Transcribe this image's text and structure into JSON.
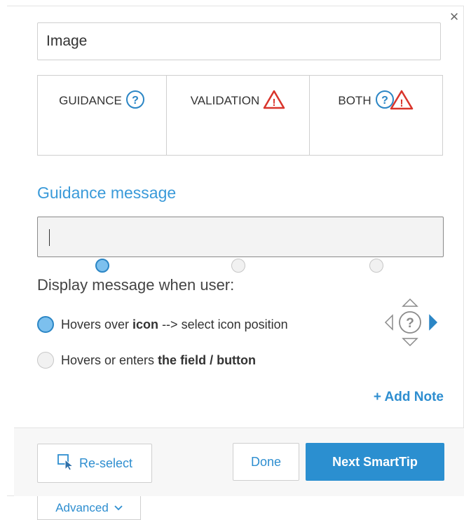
{
  "dialog": {
    "close_icon": "×",
    "name_value": "Image"
  },
  "mode": {
    "options": [
      {
        "label": "GUIDANCE",
        "icon": "help-circle-icon",
        "selected": true
      },
      {
        "label": "VALIDATION",
        "icon": "warning-triangle-icon",
        "selected": false
      },
      {
        "label": "BOTH",
        "icon": "help-and-warning-icon",
        "selected": false
      }
    ]
  },
  "guidance": {
    "title": "Guidance message",
    "message_value": ""
  },
  "display": {
    "label": "Display message when user:",
    "option_hover": {
      "part1": "Hovers ",
      "part2": "over ",
      "part3": "icon",
      "part4": " --> select icon position",
      "selected": true
    },
    "option_enter": {
      "part1": "Hovers or enters ",
      "part2": "the field / button",
      "selected": false
    },
    "position_picker_icon": "icon-position-picker"
  },
  "add_note": "+ Add Note",
  "footer": {
    "reselect_label": "Re-select",
    "reselect_icon": "cursor-select-icon",
    "done_label": "Done",
    "next_label": "Next SmartTip"
  },
  "advanced": {
    "label": "Advanced",
    "chevron": "⌄"
  },
  "colors": {
    "accent": "#3a9ad9",
    "primary_button": "#2b8fd0",
    "warning": "#d9342b"
  }
}
